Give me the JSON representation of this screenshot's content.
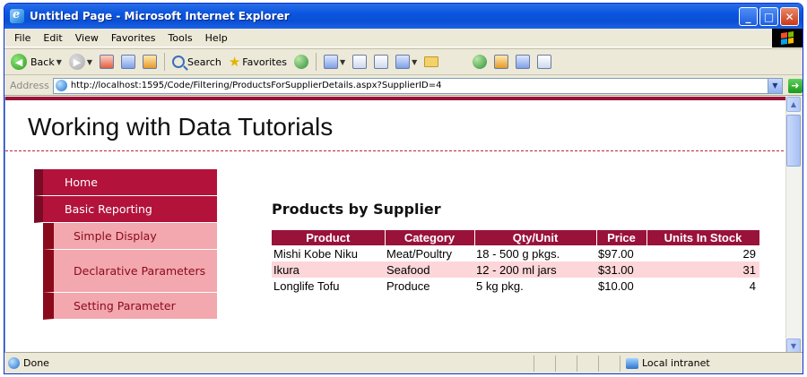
{
  "window": {
    "title": "Untitled Page - Microsoft Internet Explorer"
  },
  "menubar": {
    "items": [
      "File",
      "Edit",
      "View",
      "Favorites",
      "Tools",
      "Help"
    ]
  },
  "toolbar": {
    "back": "Back",
    "search": "Search",
    "favorites": "Favorites"
  },
  "address": {
    "label": "Address",
    "url": "http://localhost:1595/Code/Filtering/ProductsForSupplierDetails.aspx?SupplierID=4",
    "go": "Go"
  },
  "site": {
    "title": "Working with Data Tutorials"
  },
  "menu": {
    "items": [
      {
        "label": "Home"
      },
      {
        "label": "Basic Reporting"
      },
      {
        "label": "Simple Display"
      },
      {
        "label": "Declarative Parameters"
      },
      {
        "label": "Setting Parameter"
      }
    ]
  },
  "main": {
    "heading": "Products by Supplier",
    "columns": [
      "Product",
      "Category",
      "Qty/Unit",
      "Price",
      "Units In Stock"
    ],
    "rows": [
      [
        "Mishi Kobe Niku",
        "Meat/Poultry",
        "18 - 500 g pkgs.",
        "$97.00",
        "29"
      ],
      [
        "Ikura",
        "Seafood",
        "12 - 200 ml jars",
        "$31.00",
        "31"
      ],
      [
        "Longlife Tofu",
        "Produce",
        "5 kg pkg.",
        "$10.00",
        "4"
      ]
    ]
  },
  "status": {
    "text": "Done",
    "zone": "Local intranet"
  },
  "colors": {
    "brand": "#99123a",
    "menu_top": "#b3123b",
    "menu_sub": "#f3a7ae",
    "alt_row": "#fcd6d9"
  }
}
